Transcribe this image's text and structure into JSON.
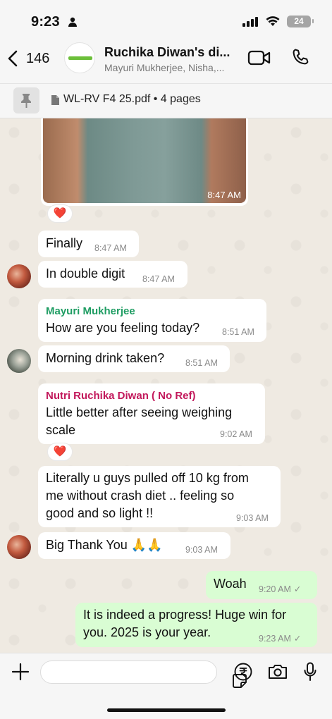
{
  "status_bar": {
    "time": "9:23",
    "battery": "24"
  },
  "header": {
    "back_count": "146",
    "title": "Ruchika Diwan's di...",
    "subtitle": "Mayuri Mukherjee, Nisha,..."
  },
  "pinned": {
    "text": "WL-RV F4 25.pdf • 4 pages"
  },
  "messages": [
    {
      "type": "image",
      "time": "8:47 AM",
      "reaction": "❤️"
    },
    {
      "type": "text",
      "text": "Finally",
      "time": "8:47 AM"
    },
    {
      "type": "text",
      "text": "In double digit",
      "time": "8:47 AM"
    },
    {
      "type": "text",
      "sender": "Mayuri Mukherjee",
      "sender_color": "#1f9d63",
      "text": "How are you feeling today?",
      "time": "8:51 AM"
    },
    {
      "type": "text",
      "text": "Morning drink taken?",
      "time": "8:51 AM"
    },
    {
      "type": "text",
      "sender": "Nutri Ruchika Diwan ( No Ref)",
      "sender_color": "#c2185b",
      "lines": [
        "Little better after seeing weighing",
        "scale"
      ],
      "time": "9:02 AM",
      "reaction": "❤️"
    },
    {
      "type": "text",
      "lines": [
        "Literally u guys pulled off 10 kg from",
        "me without crash diet .. feeling so",
        "good and so light !!"
      ],
      "time": "9:03 AM"
    },
    {
      "type": "text",
      "text": "Big Thank You 🙏🙏",
      "time": "9:03 AM"
    },
    {
      "type": "outgoing",
      "text": "Woah",
      "time": "9:20 AM",
      "status": "✓"
    },
    {
      "type": "outgoing",
      "lines": [
        "It is indeed a progress! Huge win for",
        "you. 2025 is your year."
      ],
      "time": "9:23 AM",
      "status": "✓"
    }
  ],
  "colors": {
    "outgoing_bubble": "#d9fdd3",
    "incoming_bubble": "#ffffff",
    "chat_bg": "#efeae2"
  },
  "icons": [
    "person-icon",
    "signal-icon",
    "wifi-icon",
    "battery-icon",
    "back-chevron-icon",
    "video-call-icon",
    "phone-call-icon",
    "pin-icon",
    "document-icon",
    "plus-icon",
    "sticker-icon",
    "rupee-icon",
    "camera-icon",
    "mic-icon"
  ]
}
